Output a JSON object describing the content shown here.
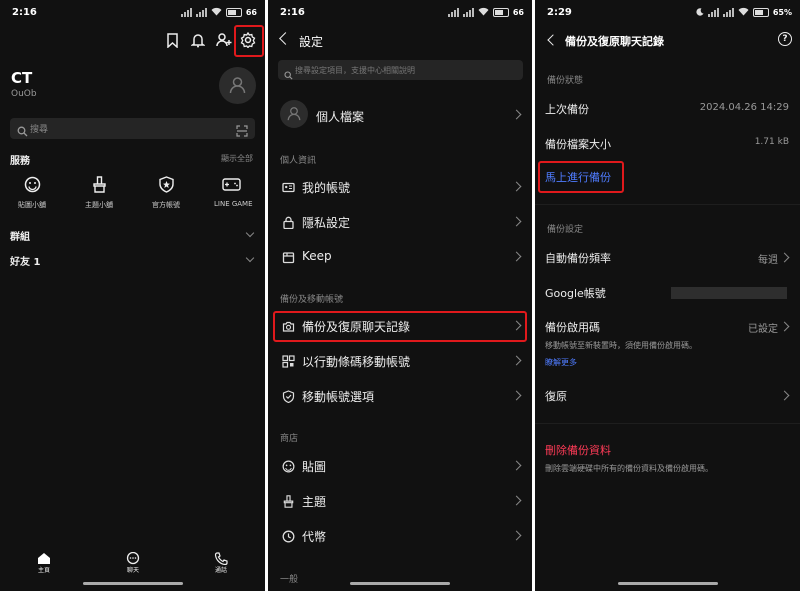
{
  "status": {
    "p1_time": "2:16",
    "p1_battery": "66",
    "p2_time": "2:16",
    "p2_battery": "66",
    "p3_time": "2:29",
    "p3_battery": "65%"
  },
  "home": {
    "profile_name": "CT",
    "profile_id": "OuOb",
    "search_placeholder": "搜尋",
    "services_title": "服務",
    "show_all": "顯示全部",
    "services": [
      {
        "label": "貼圖小舖",
        "icon": "smiley-icon"
      },
      {
        "label": "主題小舖",
        "icon": "brush-icon"
      },
      {
        "label": "官方帳號",
        "icon": "shield-star-icon"
      },
      {
        "label": "LINE GAME",
        "icon": "gamepad-icon"
      }
    ],
    "groups_label": "群組",
    "friends_label": "好友 1",
    "bottom_nav": [
      {
        "label": "主頁",
        "icon": "home-icon"
      },
      {
        "label": "聊天",
        "icon": "chat-icon"
      },
      {
        "label": "通話",
        "icon": "phone-icon"
      }
    ]
  },
  "settings": {
    "title": "設定",
    "search_placeholder": "搜尋設定項目，支援中心相關說明",
    "profile_label": "個人檔案",
    "section_personal": "個人資訊",
    "my_account": "我的帳號",
    "privacy": "隱私設定",
    "keep": "Keep",
    "section_backup": "備份及移動帳號",
    "backup_restore": "備份及復原聊天記錄",
    "qr_transfer": "以行動條碼移動帳號",
    "transfer_options": "移動帳號選項",
    "section_shop": "商店",
    "stickers": "貼圖",
    "themes": "主題",
    "coins": "代幣",
    "section_general": "一般"
  },
  "backup": {
    "title": "備份及復原聊天記錄",
    "section_status": "備份狀態",
    "last_backup_label": "上次備份",
    "last_backup_value": "2024.04.26 14:29",
    "size_label": "備份檔案大小",
    "size_value": "1.71 kB",
    "backup_now": "馬上進行備份",
    "section_settings": "備份設定",
    "auto_freq_label": "自動備份頻率",
    "auto_freq_value": "每週",
    "google_label": "Google帳號",
    "pin_label": "備份啟用碼",
    "pin_value": "已設定",
    "pin_desc": "移動帳號至新裝置時，須使用備份啟用碼。",
    "learn_more": "瞭解更多",
    "restore_label": "復原",
    "delete_label": "刪除備份資料",
    "delete_desc": "刪除雲端硬碟中所有的備份資料及備份啟用碼。"
  },
  "colors": {
    "accent_red": "#e0191c",
    "link_blue": "#4f7cff",
    "danger_red": "#ff3b57",
    "background": "#111111"
  }
}
